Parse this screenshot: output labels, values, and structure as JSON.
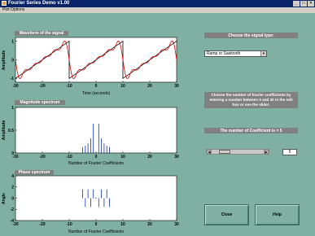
{
  "window": {
    "title": "Fourier Series Demo v1.00"
  },
  "menu": {
    "item": "Plot Options"
  },
  "plots": {
    "waveform": {
      "label": "Waveform of the signal",
      "ylabel": "Amplitude",
      "xlabel": "Time (seconds)",
      "xticks": [
        "-30",
        "-20",
        "-10",
        "0",
        "10",
        "20",
        "30"
      ],
      "yticks": [
        "1",
        "0",
        "-1"
      ]
    },
    "magnitude": {
      "label": "Magnitude spectrum",
      "ylabel": "Amplitude",
      "xlabel": "Number of Fourier Coefficients",
      "xticks": [
        "-30",
        "-20",
        "-10",
        "0",
        "10",
        "20",
        "30"
      ],
      "yticks": [
        "1",
        "0.5",
        "0"
      ]
    },
    "phase": {
      "label": "Phase spectrum",
      "ylabel": "Angle",
      "xlabel": "Number of Fourier Coefficients",
      "xticks": [
        "-30",
        "-20",
        "-10",
        "0",
        "10",
        "20",
        "30"
      ],
      "yticks": [
        "4",
        "2",
        "0",
        "-2",
        "-4"
      ]
    }
  },
  "chart_data": [
    {
      "type": "line",
      "title": "Waveform of the signal",
      "xlabel": "Time (seconds)",
      "ylabel": "Amplitude",
      "xlim": [
        -30,
        30
      ],
      "ylim": [
        -1,
        1
      ],
      "series": [
        {
          "name": "",
          "x": [
            -30,
            -10,
            -10,
            10,
            10,
            30
          ],
          "y": [
            -1,
            1,
            -1,
            1,
            -1,
            1
          ]
        }
      ]
    },
    {
      "type": "bar",
      "title": "Magnitude spectrum",
      "xlabel": "Number of Fourier Coefficients",
      "ylabel": "Amplitude",
      "xlim": [
        -30,
        30
      ],
      "ylim": [
        0,
        1
      ],
      "x": [
        -5,
        -4,
        -3,
        -2,
        -1,
        0,
        1,
        2,
        3,
        4,
        5
      ],
      "values": [
        0.13,
        0.16,
        0.21,
        0.32,
        0.64,
        0,
        0.64,
        0.32,
        0.21,
        0.16,
        0.13
      ]
    },
    {
      "type": "bar",
      "title": "Phase spectrum",
      "xlabel": "Number of Fourier Coefficients",
      "ylabel": "Angle",
      "xlim": [
        -30,
        30
      ],
      "ylim": [
        -4,
        4
      ],
      "x": [
        -5,
        -4,
        -3,
        -2,
        -1,
        0,
        1,
        2,
        3,
        4,
        5
      ],
      "values": [
        1.57,
        -1.57,
        1.57,
        -1.57,
        1.57,
        0,
        -1.57,
        1.57,
        -1.57,
        1.57,
        -1.57
      ]
    }
  ],
  "controls": {
    "signal_type_label": "Choose the signal type:",
    "signal_type_value": "Ramp or Sawtooth",
    "instructions": "Choose the number of fourier coefficients by entering a number  between 0 and 30 in the edit box or use the slider.",
    "coeff_label": "The number of Coefficient is = 5",
    "slider_value": 5,
    "slider_min": 0,
    "slider_max": 30,
    "edit_value": "5",
    "close_label": "Close",
    "help_label": "Help"
  }
}
